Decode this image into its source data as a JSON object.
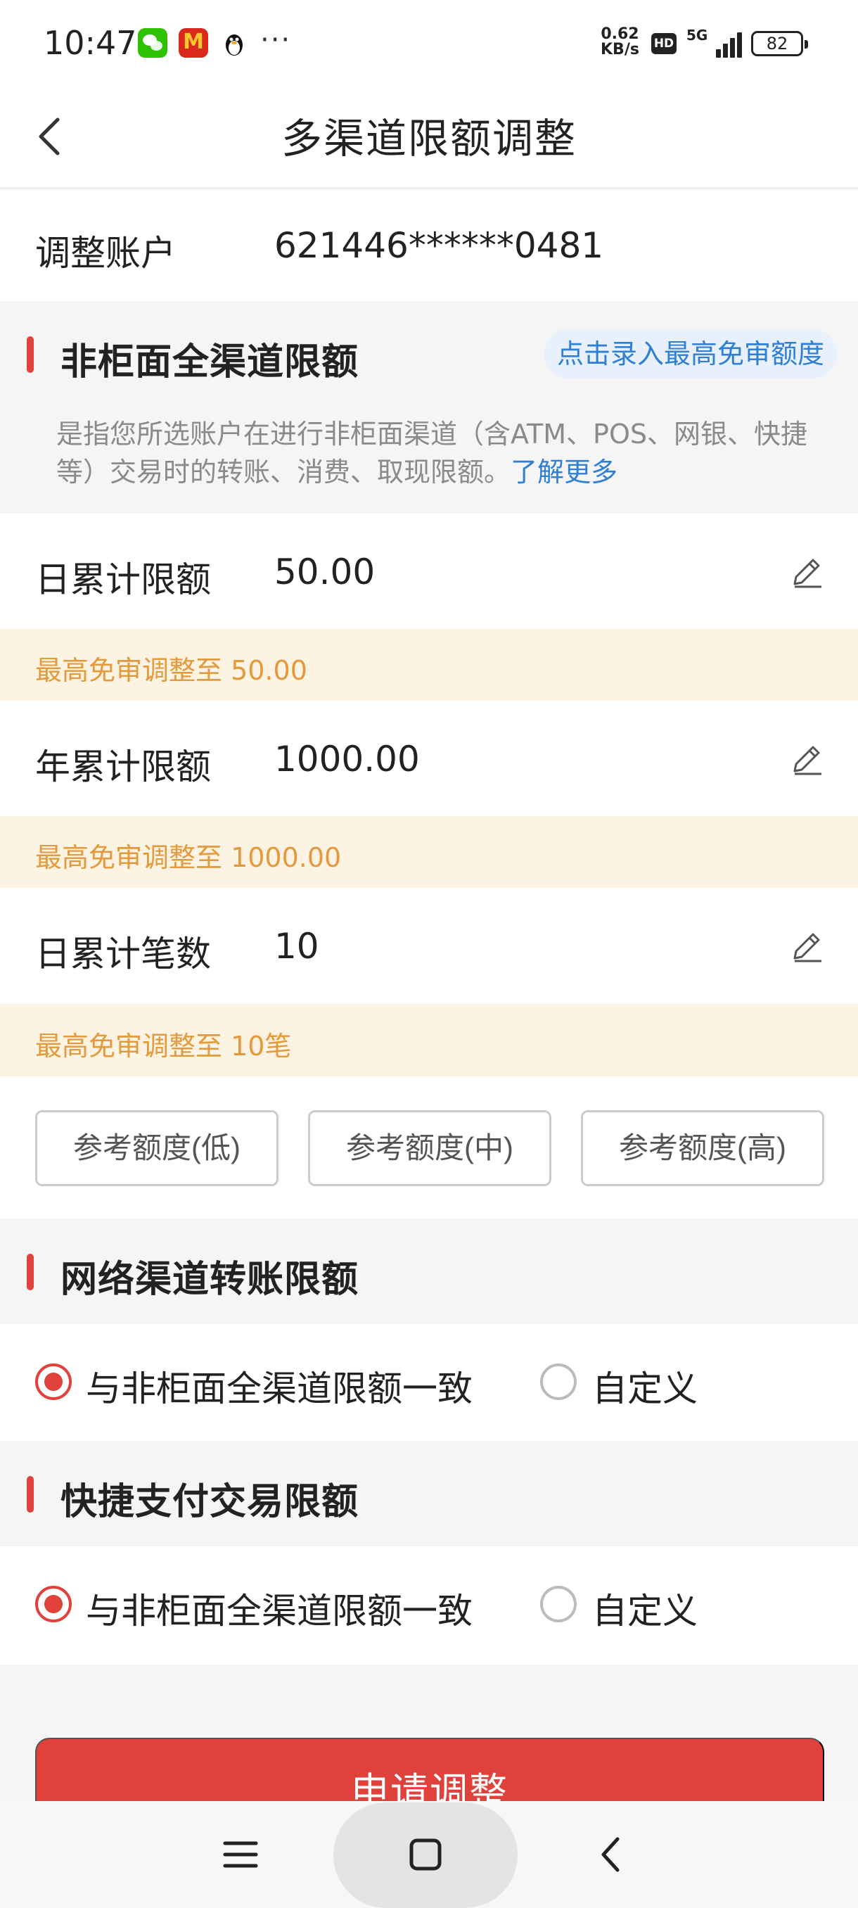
{
  "status_bar": {
    "time": "10:47",
    "mcd_label": "M",
    "more": "···",
    "speed_value": "0.62",
    "speed_unit": "KB/s",
    "hd": "HD",
    "network": "5G",
    "battery": "82"
  },
  "header": {
    "title": "多渠道限额调整",
    "back_icon": "chevron-left-icon"
  },
  "account": {
    "label": "调整账户",
    "value": "621446******0481"
  },
  "non_counter": {
    "title": "非柜面全渠道限额",
    "quick_entry": "点击录入最高免审额度",
    "description": "是指您所选账户在进行非柜面渠道（含ATM、POS、网银、快捷等）交易时的转账、消费、取现限额。",
    "learn_more": "了解更多",
    "limits": [
      {
        "label": "日累计限额",
        "value": "50.00",
        "hint": "最高免审调整至 50.00"
      },
      {
        "label": "年累计限额",
        "value": "1000.00",
        "hint": "最高免审调整至 1000.00"
      },
      {
        "label": "日累计笔数",
        "value": "10",
        "hint": "最高免审调整至 10笔"
      }
    ],
    "reference_buttons": [
      "参考额度(低)",
      "参考额度(中)",
      "参考额度(高)"
    ]
  },
  "network_transfer": {
    "title": "网络渠道转账限额",
    "option_same": "与非柜面全渠道限额一致",
    "option_custom": "自定义",
    "selected": "same"
  },
  "quick_pay": {
    "title": "快捷支付交易限额",
    "option_same": "与非柜面全渠道限额一致",
    "option_custom": "自定义",
    "selected": "same"
  },
  "submit_label": "申请调整",
  "colors": {
    "accent": "#e0413a",
    "link": "#2f7fd4",
    "hint_text": "#e39a3c",
    "hint_bg": "#fdf3e3"
  },
  "nav_icons": [
    "menu-icon",
    "home-square-icon",
    "back-icon"
  ]
}
